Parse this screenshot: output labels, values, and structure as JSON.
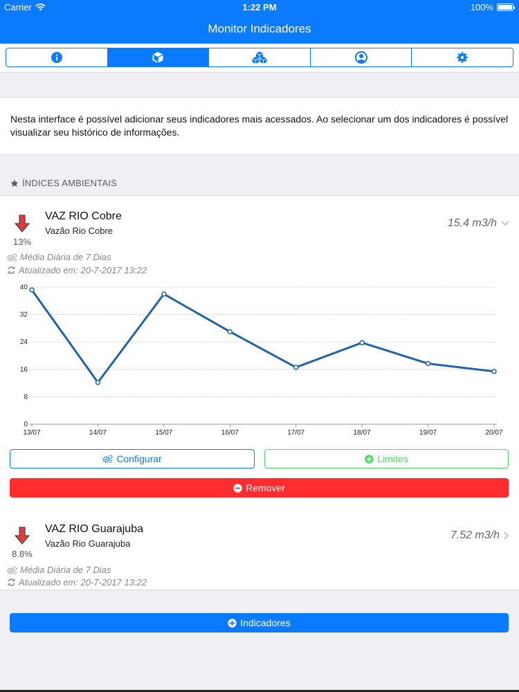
{
  "status_bar": {
    "carrier": "Carrier",
    "time": "1:22 PM",
    "battery": "100%"
  },
  "nav": {
    "title": "Monitor Indicadores"
  },
  "tabs": [
    {
      "icon": "info-icon",
      "active": false
    },
    {
      "icon": "cube-icon",
      "active": true
    },
    {
      "icon": "cubes-icon",
      "active": false
    },
    {
      "icon": "user-icon",
      "active": false
    },
    {
      "icon": "gear-icon",
      "active": false
    }
  ],
  "intro": {
    "text": "Nesta interface é possível adicionar seus indicadores mais acessados. Ao selecionar um dos indicadores é possível visualizar seu histórico de informações."
  },
  "section": {
    "title": "ÍNDICES AMBIENTAIS"
  },
  "indicators": [
    {
      "title": "VAZ RIO Cobre",
      "subtitle": "Vazão Rio Cobre",
      "percent": "13%",
      "value": "15.4 m3/h",
      "average": "Média Diária de 7 Dias",
      "updated": "Atualizado em: 20-7-2017 13:22",
      "expanded": true,
      "trend": "down"
    },
    {
      "title": "VAZ RIO Guarajuba",
      "subtitle": "Vazão Rio Guarajuba",
      "percent": "8.8%",
      "value": "7.52 m3/h",
      "average": "Média Diária de 7 Dias",
      "updated": "Atualizado em: 20-7-2017 13:22",
      "expanded": false,
      "trend": "down"
    }
  ],
  "chart_data": {
    "type": "line",
    "x": [
      "13/07",
      "14/07",
      "15/07",
      "16/07",
      "17/07",
      "18/07",
      "19/07",
      "20/07"
    ],
    "series": [
      {
        "values": [
          39.2,
          12.2,
          38.0,
          27.0,
          16.6,
          23.8,
          17.7,
          15.4
        ]
      }
    ],
    "yticks": [
      "0",
      "8",
      "16",
      "24",
      "32",
      "40"
    ],
    "ylim": [
      0,
      40
    ],
    "grid": true,
    "line_color": "#1e64aa"
  },
  "buttons": {
    "configurar": "Configurar",
    "limites": "Limites",
    "remover": "Remover",
    "indicadores": "Indicadores"
  },
  "colors": {
    "primary": "#0a7bff",
    "success": "#4cd964",
    "danger": "#ff2d2d",
    "trend_down": "#e03c3c"
  }
}
